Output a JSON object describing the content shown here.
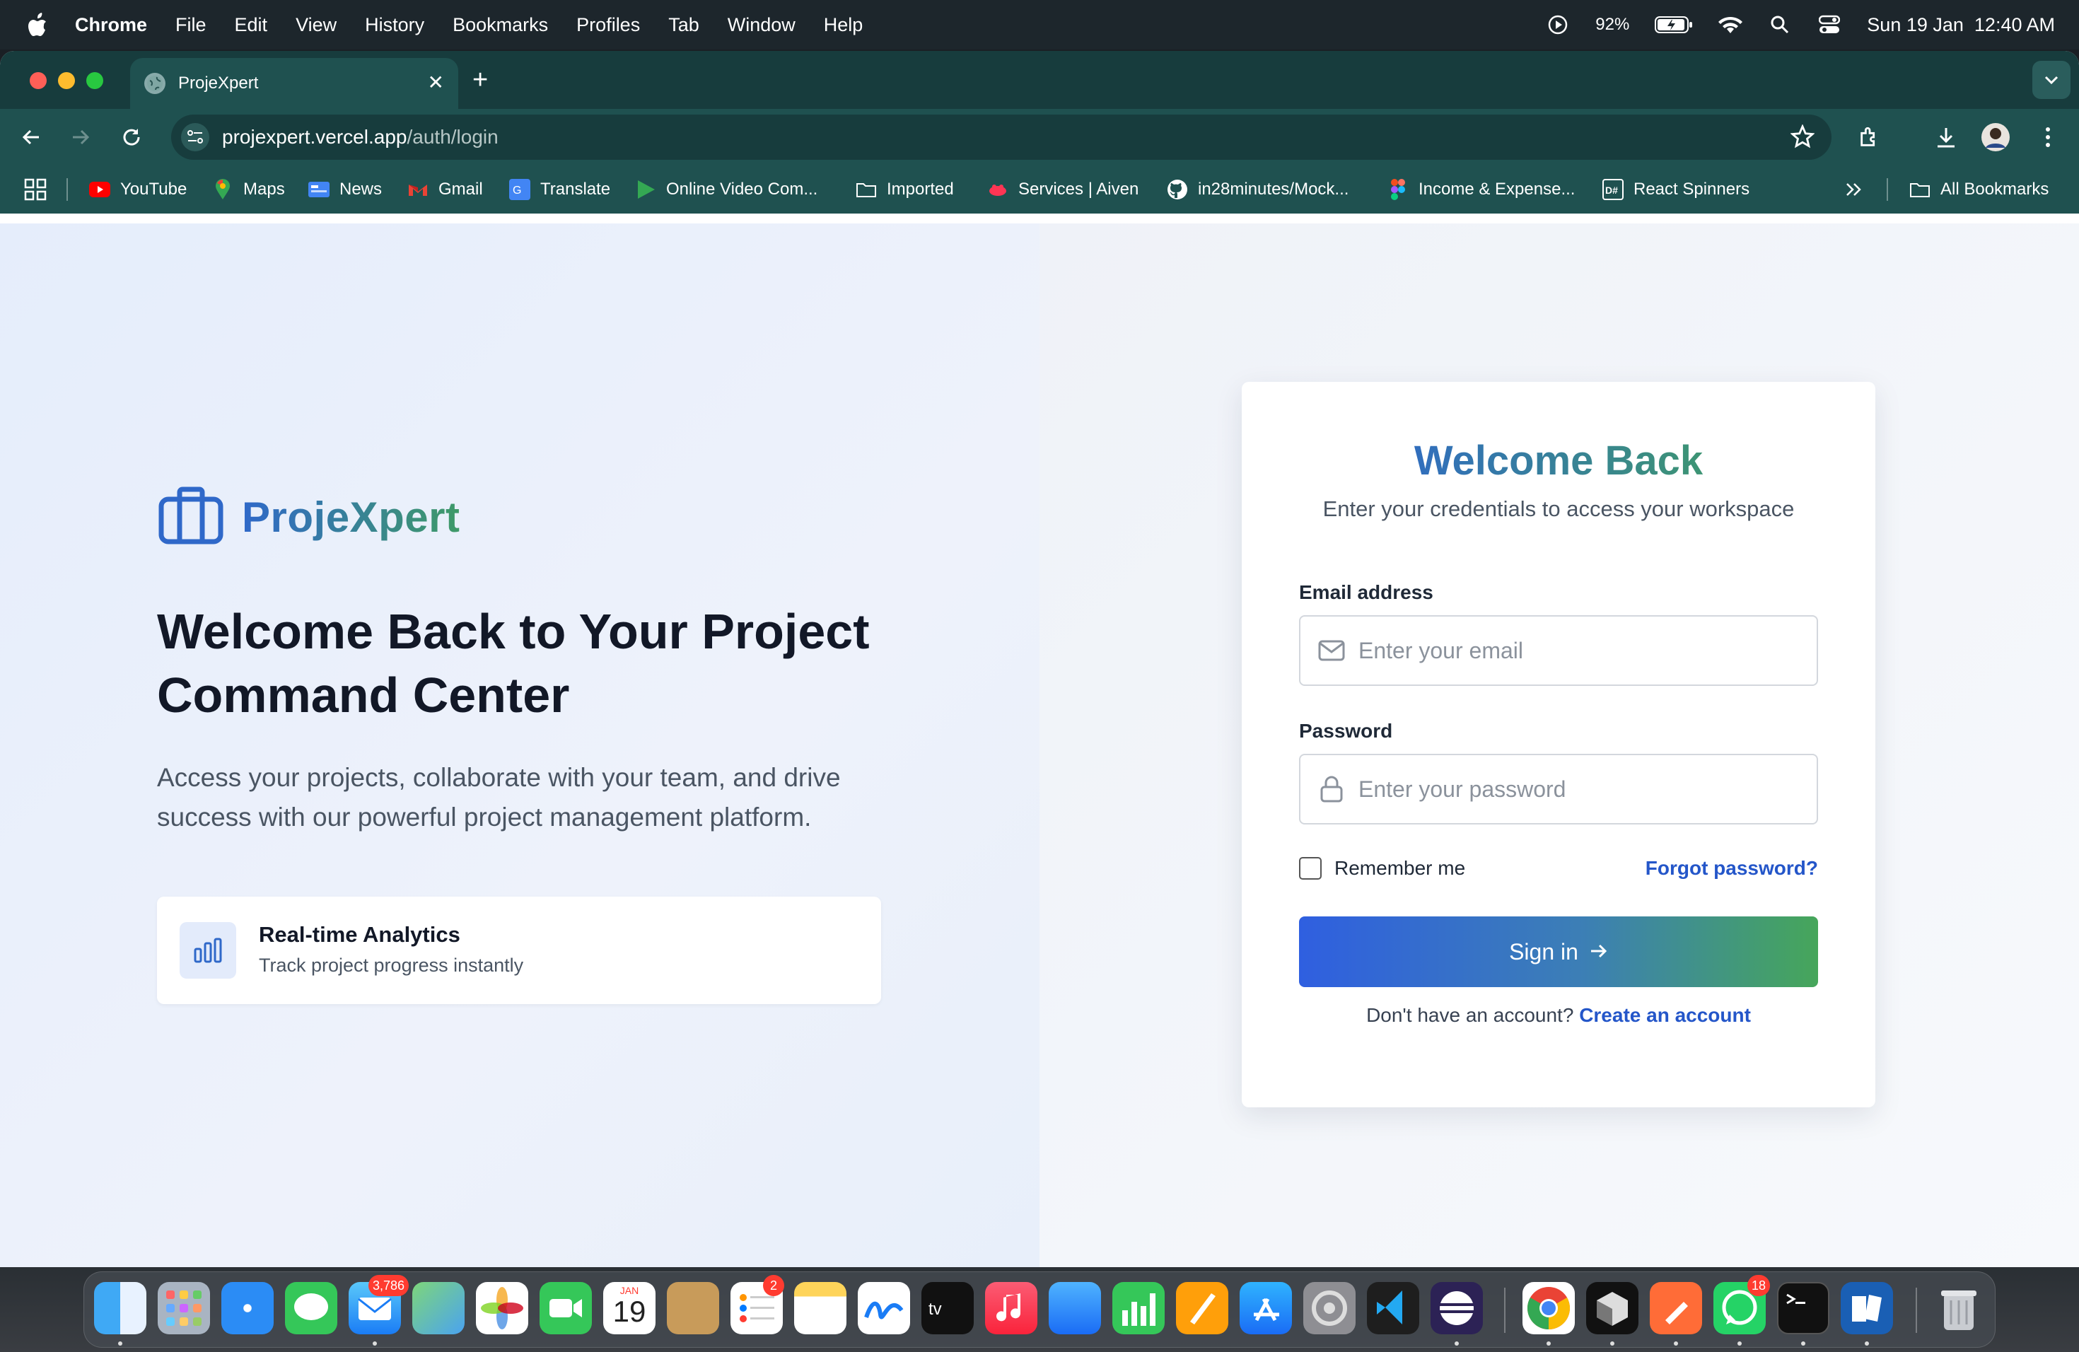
{
  "menubar": {
    "app": "Chrome",
    "items": [
      "File",
      "Edit",
      "View",
      "History",
      "Bookmarks",
      "Profiles",
      "Tab",
      "Window",
      "Help"
    ],
    "battery": "92%",
    "datetime": "Sun 19 Jan  12:40 AM"
  },
  "tab": {
    "title": "ProjeXpert"
  },
  "omnibox": {
    "host": "projexpert.vercel.app",
    "path": "/auth/login"
  },
  "bookmarks": [
    {
      "label": "YouTube",
      "icon": "youtube-icon",
      "color": "#ff0000"
    },
    {
      "label": "Maps",
      "icon": "maps-icon",
      "color": "#34a853"
    },
    {
      "label": "News",
      "icon": "news-icon",
      "color": "#4285f4"
    },
    {
      "label": "Gmail",
      "icon": "gmail-icon",
      "color": "#ea4335"
    },
    {
      "label": "Translate",
      "icon": "translate-icon",
      "color": "#4285f4"
    },
    {
      "label": "Online Video Com...",
      "icon": "play-icon",
      "color": "#34a853"
    },
    {
      "label": "Imported",
      "icon": "folder-icon",
      "color": "#ffffff"
    },
    {
      "label": "Services | Aiven",
      "icon": "aiven-icon",
      "color": "#ff3554"
    },
    {
      "label": "in28minutes/Mock...",
      "icon": "github-icon",
      "color": "#ffffff"
    },
    {
      "label": "Income & Expense...",
      "icon": "figma-icon",
      "color": "#a259ff"
    },
    {
      "label": "React Spinners",
      "icon": "react-spinners-icon",
      "color": "#ffffff"
    }
  ],
  "all_bookmarks": "All Bookmarks",
  "brand": {
    "name": "ProjeXpert"
  },
  "hero": {
    "title": "Welcome Back to Your Project Command Center",
    "subtitle": "Access your projects, collaborate with your team, and drive success with our powerful project management platform."
  },
  "feature": {
    "title": "Real-time Analytics",
    "subtitle": "Track project progress instantly"
  },
  "login": {
    "title": "Welcome Back",
    "subtitle": "Enter your credentials to access your workspace",
    "email_label": "Email address",
    "email_placeholder": "Enter your email",
    "password_label": "Password",
    "password_placeholder": "Enter your password",
    "remember_label": "Remember me",
    "forgot_label": "Forgot password?",
    "signin_label": "Sign in",
    "signup_prompt": "Don't have an account?",
    "signup_link": "Create an account"
  },
  "dock": {
    "mail_badge": "3,786",
    "reminders_badge": "2",
    "whatsapp_badge": "18",
    "calendar_month": "JAN",
    "calendar_day": "19"
  },
  "colors": {
    "brand_blue": "#2f68c9",
    "brand_green": "#3f9a68",
    "link": "#2456c9"
  }
}
